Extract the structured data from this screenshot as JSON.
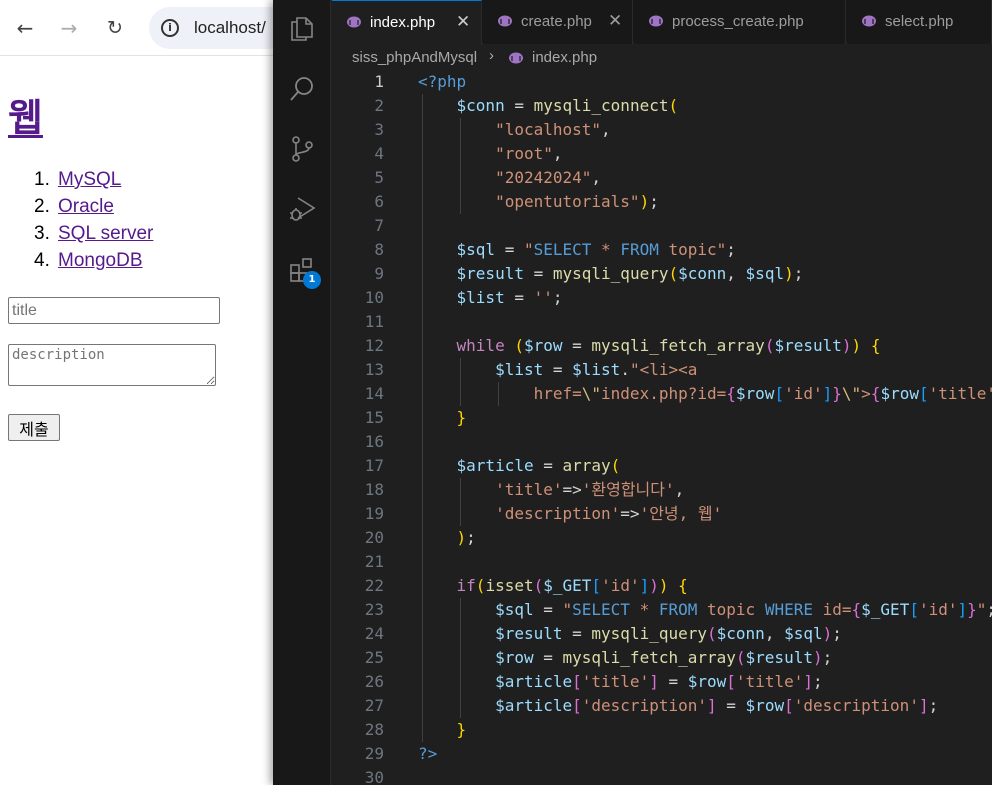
{
  "browser": {
    "url": "localhost/",
    "heading": "웹",
    "topics": [
      {
        "num": "1.",
        "label": "MySQL"
      },
      {
        "num": "2.",
        "label": "Oracle"
      },
      {
        "num": "3.",
        "label": "SQL server"
      },
      {
        "num": "4.",
        "label": "MongoDB"
      }
    ],
    "form": {
      "title_placeholder": "title",
      "description_placeholder": "description",
      "submit_label": "제출"
    }
  },
  "vscode": {
    "activity_bar": {
      "items": [
        "files-icon",
        "search-icon",
        "source-control-icon",
        "run-debug-icon",
        "extensions-icon"
      ],
      "extensions_badge": "1"
    },
    "tabs": [
      {
        "label": "index.php",
        "active": true
      },
      {
        "label": "create.php",
        "active": false
      },
      {
        "label": "process_create.php",
        "active": false
      },
      {
        "label": "select.php",
        "active": false
      }
    ],
    "breadcrumb": {
      "folder": "siss_phpAndMysql",
      "file": "index.php"
    },
    "accent_color": "#0078d4",
    "code_lines": [
      {
        "n": "1",
        "tokens": [
          [
            "t-tag",
            "<?php"
          ]
        ]
      },
      {
        "n": "2",
        "tokens": [
          [
            "t-op",
            "    "
          ],
          [
            "t-var",
            "$conn"
          ],
          [
            "t-op",
            " = "
          ],
          [
            "t-fn",
            "mysqli_connect"
          ],
          [
            "t-p1",
            "("
          ]
        ]
      },
      {
        "n": "3",
        "tokens": [
          [
            "t-op",
            "        "
          ],
          [
            "t-str",
            "\"localhost\""
          ],
          [
            "t-op",
            ","
          ]
        ]
      },
      {
        "n": "4",
        "tokens": [
          [
            "t-op",
            "        "
          ],
          [
            "t-str",
            "\"root\""
          ],
          [
            "t-op",
            ","
          ]
        ]
      },
      {
        "n": "5",
        "tokens": [
          [
            "t-op",
            "        "
          ],
          [
            "t-str",
            "\"20242024\""
          ],
          [
            "t-op",
            ","
          ]
        ]
      },
      {
        "n": "6",
        "tokens": [
          [
            "t-op",
            "        "
          ],
          [
            "t-str",
            "\"opentutorials\""
          ],
          [
            "t-p1",
            ")"
          ],
          [
            "t-op",
            ";"
          ]
        ]
      },
      {
        "n": "7",
        "tokens": []
      },
      {
        "n": "8",
        "tokens": [
          [
            "t-op",
            "    "
          ],
          [
            "t-var",
            "$sql"
          ],
          [
            "t-op",
            " = "
          ],
          [
            "t-str",
            "\""
          ],
          [
            "t-sqlkw",
            "SELECT"
          ],
          [
            "t-str",
            " * "
          ],
          [
            "t-sqlkw",
            "FROM"
          ],
          [
            "t-str",
            " topic\""
          ],
          [
            "t-op",
            ";"
          ]
        ]
      },
      {
        "n": "9",
        "tokens": [
          [
            "t-op",
            "    "
          ],
          [
            "t-var",
            "$result"
          ],
          [
            "t-op",
            " = "
          ],
          [
            "t-fn",
            "mysqli_query"
          ],
          [
            "t-p1",
            "("
          ],
          [
            "t-var",
            "$conn"
          ],
          [
            "t-op",
            ", "
          ],
          [
            "t-var",
            "$sql"
          ],
          [
            "t-p1",
            ")"
          ],
          [
            "t-op",
            ";"
          ]
        ]
      },
      {
        "n": "10",
        "tokens": [
          [
            "t-op",
            "    "
          ],
          [
            "t-var",
            "$list"
          ],
          [
            "t-op",
            " = "
          ],
          [
            "t-str",
            "''"
          ],
          [
            "t-op",
            ";"
          ]
        ]
      },
      {
        "n": "11",
        "tokens": []
      },
      {
        "n": "12",
        "tokens": [
          [
            "t-op",
            "    "
          ],
          [
            "t-kw",
            "while"
          ],
          [
            "t-op",
            " "
          ],
          [
            "t-p1",
            "("
          ],
          [
            "t-var",
            "$row"
          ],
          [
            "t-op",
            " = "
          ],
          [
            "t-fn",
            "mysqli_fetch_array"
          ],
          [
            "t-p2",
            "("
          ],
          [
            "t-var",
            "$result"
          ],
          [
            "t-p2",
            ")"
          ],
          [
            "t-p1",
            ")"
          ],
          [
            "t-op",
            " "
          ],
          [
            "t-p1",
            "{"
          ]
        ]
      },
      {
        "n": "13",
        "tokens": [
          [
            "t-op",
            "        "
          ],
          [
            "t-var",
            "$list"
          ],
          [
            "t-op",
            " = "
          ],
          [
            "t-var",
            "$list"
          ],
          [
            "t-op",
            "."
          ],
          [
            "t-str",
            "\"<li><a"
          ]
        ]
      },
      {
        "n": "14",
        "tokens": [
          [
            "t-op",
            "            "
          ],
          [
            "t-str",
            "href="
          ],
          [
            "t-esc",
            "\\\""
          ],
          [
            "t-str",
            "index.php?id="
          ],
          [
            "t-p2",
            "{"
          ],
          [
            "t-var",
            "$row"
          ],
          [
            "t-p3",
            "["
          ],
          [
            "t-str",
            "'id'"
          ],
          [
            "t-p3",
            "]"
          ],
          [
            "t-p2",
            "}"
          ],
          [
            "t-esc",
            "\\\""
          ],
          [
            "t-str",
            ">"
          ],
          [
            "t-p2",
            "{"
          ],
          [
            "t-var",
            "$row"
          ],
          [
            "t-p3",
            "["
          ],
          [
            "t-str",
            "'title'"
          ]
        ]
      },
      {
        "n": "15",
        "tokens": [
          [
            "t-op",
            "    "
          ],
          [
            "t-p1",
            "}"
          ]
        ]
      },
      {
        "n": "16",
        "tokens": []
      },
      {
        "n": "17",
        "tokens": [
          [
            "t-op",
            "    "
          ],
          [
            "t-var",
            "$article"
          ],
          [
            "t-op",
            " = "
          ],
          [
            "t-fn",
            "array"
          ],
          [
            "t-p1",
            "("
          ]
        ]
      },
      {
        "n": "18",
        "tokens": [
          [
            "t-op",
            "        "
          ],
          [
            "t-str",
            "'title'"
          ],
          [
            "t-op",
            "=>"
          ],
          [
            "t-str",
            "'환영합니다'"
          ],
          [
            "t-op",
            ","
          ]
        ]
      },
      {
        "n": "19",
        "tokens": [
          [
            "t-op",
            "        "
          ],
          [
            "t-str",
            "'description'"
          ],
          [
            "t-op",
            "=>"
          ],
          [
            "t-str",
            "'안녕, 웹'"
          ]
        ]
      },
      {
        "n": "20",
        "tokens": [
          [
            "t-op",
            "    "
          ],
          [
            "t-p1",
            ")"
          ],
          [
            "t-op",
            ";"
          ]
        ]
      },
      {
        "n": "21",
        "tokens": []
      },
      {
        "n": "22",
        "tokens": [
          [
            "t-op",
            "    "
          ],
          [
            "t-kw",
            "if"
          ],
          [
            "t-p1",
            "("
          ],
          [
            "t-fn",
            "isset"
          ],
          [
            "t-p2",
            "("
          ],
          [
            "t-var",
            "$_GET"
          ],
          [
            "t-p3",
            "["
          ],
          [
            "t-str",
            "'id'"
          ],
          [
            "t-p3",
            "]"
          ],
          [
            "t-p2",
            ")"
          ],
          [
            "t-p1",
            ")"
          ],
          [
            "t-op",
            " "
          ],
          [
            "t-p1",
            "{"
          ]
        ]
      },
      {
        "n": "23",
        "tokens": [
          [
            "t-op",
            "        "
          ],
          [
            "t-var",
            "$sql"
          ],
          [
            "t-op",
            " = "
          ],
          [
            "t-str",
            "\""
          ],
          [
            "t-sqlkw",
            "SELECT"
          ],
          [
            "t-str",
            " * "
          ],
          [
            "t-sqlkw",
            "FROM"
          ],
          [
            "t-str",
            " topic "
          ],
          [
            "t-sqlkw",
            "WHERE"
          ],
          [
            "t-str",
            " id="
          ],
          [
            "t-p2",
            "{"
          ],
          [
            "t-var",
            "$_GET"
          ],
          [
            "t-p3",
            "["
          ],
          [
            "t-str",
            "'id'"
          ],
          [
            "t-p3",
            "]"
          ],
          [
            "t-p2",
            "}"
          ],
          [
            "t-str",
            "\""
          ],
          [
            "t-op",
            ";"
          ]
        ]
      },
      {
        "n": "24",
        "tokens": [
          [
            "t-op",
            "        "
          ],
          [
            "t-var",
            "$result"
          ],
          [
            "t-op",
            " = "
          ],
          [
            "t-fn",
            "mysqli_query"
          ],
          [
            "t-p2",
            "("
          ],
          [
            "t-var",
            "$conn"
          ],
          [
            "t-op",
            ", "
          ],
          [
            "t-var",
            "$sql"
          ],
          [
            "t-p2",
            ")"
          ],
          [
            "t-op",
            ";"
          ]
        ]
      },
      {
        "n": "25",
        "tokens": [
          [
            "t-op",
            "        "
          ],
          [
            "t-var",
            "$row"
          ],
          [
            "t-op",
            " = "
          ],
          [
            "t-fn",
            "mysqli_fetch_array"
          ],
          [
            "t-p2",
            "("
          ],
          [
            "t-var",
            "$result"
          ],
          [
            "t-p2",
            ")"
          ],
          [
            "t-op",
            ";"
          ]
        ]
      },
      {
        "n": "26",
        "tokens": [
          [
            "t-op",
            "        "
          ],
          [
            "t-var",
            "$article"
          ],
          [
            "t-p2",
            "["
          ],
          [
            "t-str",
            "'title'"
          ],
          [
            "t-p2",
            "]"
          ],
          [
            "t-op",
            " = "
          ],
          [
            "t-var",
            "$row"
          ],
          [
            "t-p2",
            "["
          ],
          [
            "t-str",
            "'title'"
          ],
          [
            "t-p2",
            "]"
          ],
          [
            "t-op",
            ";"
          ]
        ]
      },
      {
        "n": "27",
        "tokens": [
          [
            "t-op",
            "        "
          ],
          [
            "t-var",
            "$article"
          ],
          [
            "t-p2",
            "["
          ],
          [
            "t-str",
            "'description'"
          ],
          [
            "t-p2",
            "]"
          ],
          [
            "t-op",
            " = "
          ],
          [
            "t-var",
            "$row"
          ],
          [
            "t-p2",
            "["
          ],
          [
            "t-str",
            "'description'"
          ],
          [
            "t-p2",
            "]"
          ],
          [
            "t-op",
            ";"
          ]
        ]
      },
      {
        "n": "28",
        "tokens": [
          [
            "t-op",
            "    "
          ],
          [
            "t-p1",
            "}"
          ]
        ]
      },
      {
        "n": "29",
        "tokens": [
          [
            "t-tag",
            "?>"
          ]
        ]
      },
      {
        "n": "30",
        "tokens": []
      }
    ]
  }
}
